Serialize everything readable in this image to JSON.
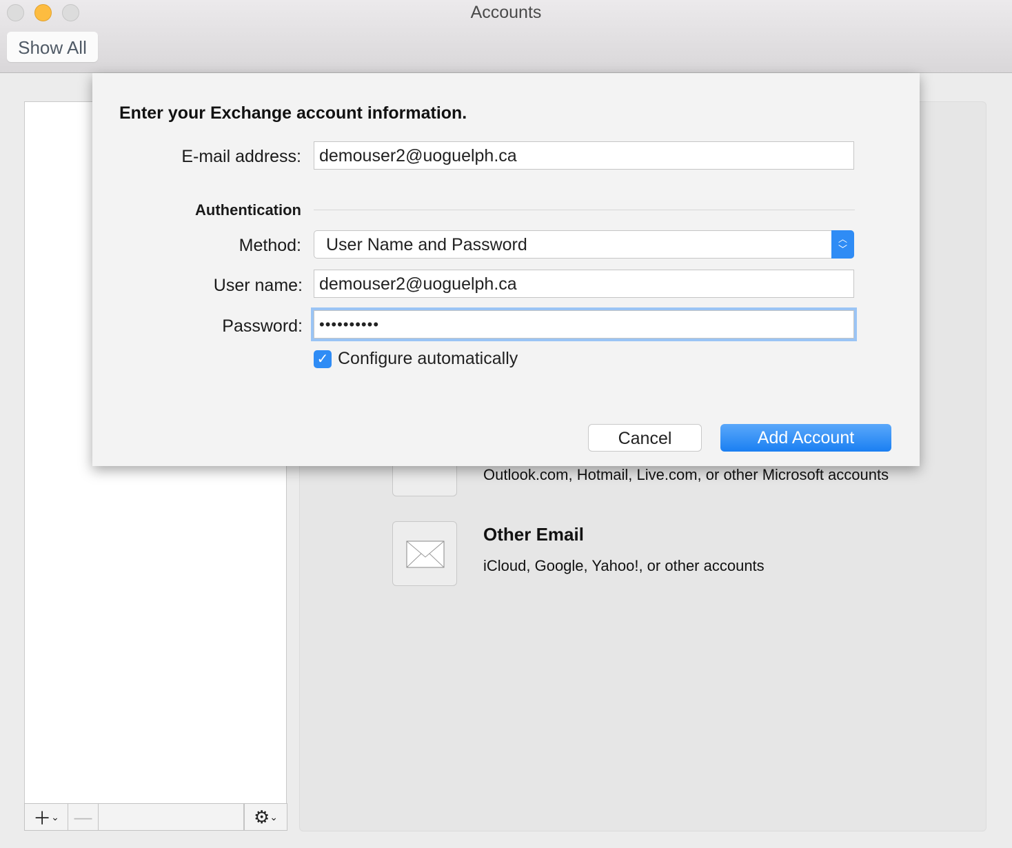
{
  "window": {
    "title": "Accounts",
    "show_all": "Show All"
  },
  "dialog": {
    "heading": "Enter your Exchange account information.",
    "email_label": "E-mail address:",
    "email_value": "demouser2@uoguelph.ca",
    "auth_heading": "Authentication",
    "method_label": "Method:",
    "method_value": "User Name and Password",
    "username_label": "User name:",
    "username_value": "demouser2@uoguelph.ca",
    "password_label": "Password:",
    "password_value": "••••••••••",
    "configure_label": "Configure automatically",
    "configure_checked": true,
    "cancel": "Cancel",
    "add": "Add Account"
  },
  "accounts": [
    {
      "desc": "Outlook.com, Hotmail, Live.com, or other Microsoft accounts",
      "icon": "outlook-icon"
    },
    {
      "title": "Other Email",
      "desc": "iCloud, Google, Yahoo!, or other accounts",
      "icon": "envelope-icon"
    }
  ],
  "colors": {
    "accent": "#2f8cf5",
    "focus": "#9ac4f5"
  }
}
